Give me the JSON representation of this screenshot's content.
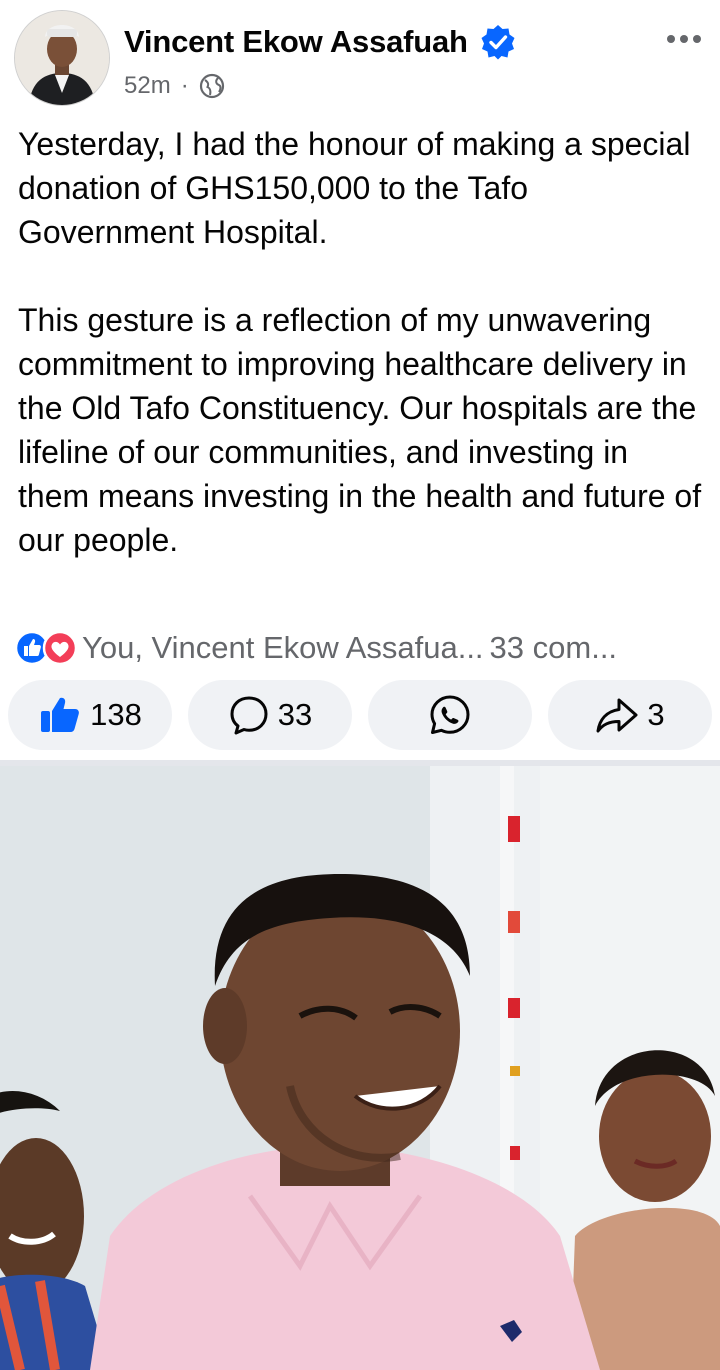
{
  "post": {
    "author": "Vincent Ekow Assafuah",
    "time": "52m",
    "separator": "·",
    "audience_icon": "globe-icon",
    "verified_icon": "verified-badge-icon",
    "text": {
      "p1": "Yesterday, I had the honour of making a special donation of GHS150,000 to the Tafo Government Hospital.",
      "p2": "This gesture is a reflection of my unwavering commitment to improving healthcare delivery in the Old Tafo Constituency. Our hospitals are the lifeline of our communities, and investing in them means investing in the health and future of our people."
    }
  },
  "reactions": {
    "names": "You, Vincent Ekow Assafua...",
    "comments": "33 com...",
    "icons": [
      "like-icon",
      "love-icon"
    ]
  },
  "actions": {
    "like_count": "138",
    "comment_count": "33",
    "share_count": "3",
    "icons": [
      "like-icon",
      "comment-icon",
      "whatsapp-icon",
      "share-icon"
    ]
  },
  "colors": {
    "brand_blue": "#0866ff",
    "love_red": "#f33e58",
    "secondary_text": "#65676b",
    "pill_bg": "#f0f2f5"
  }
}
